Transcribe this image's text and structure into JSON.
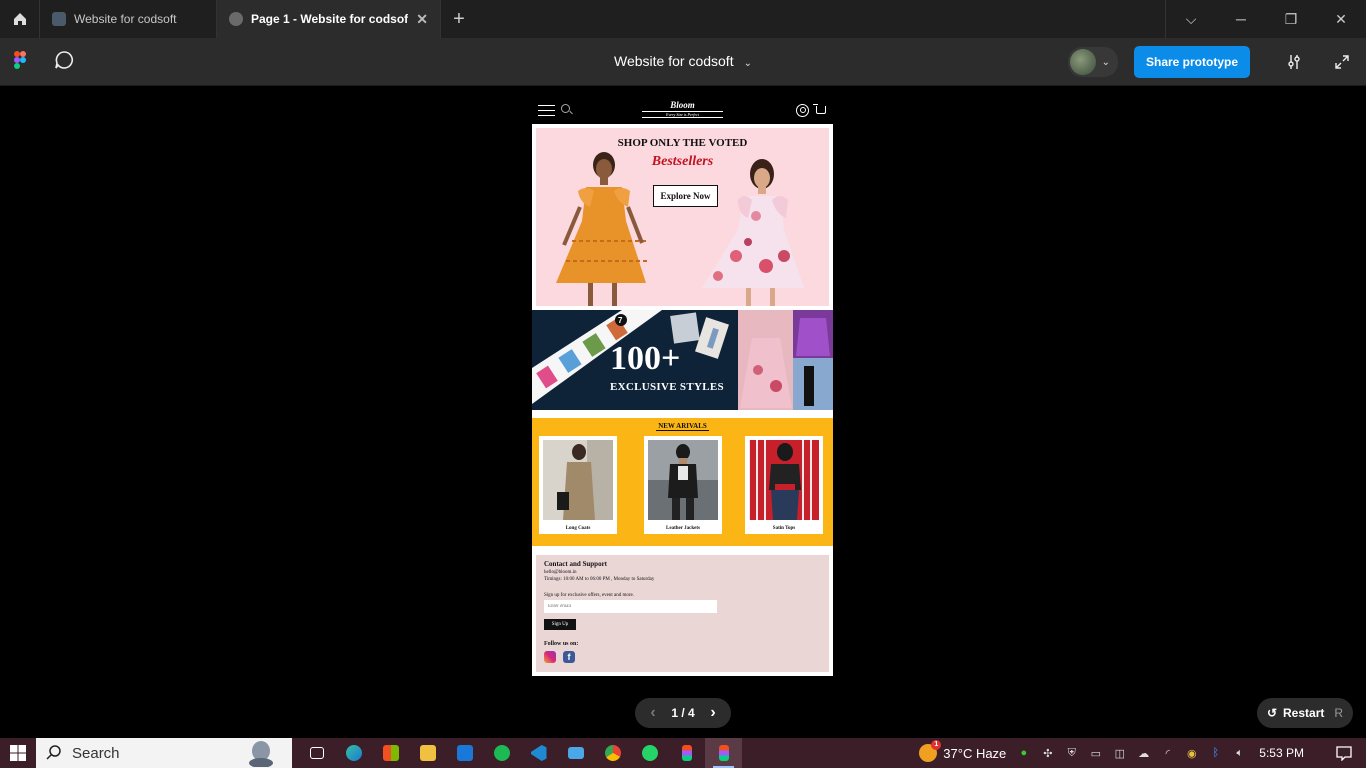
{
  "browser": {
    "tabs": [
      {
        "title": "Website for codsoft",
        "active": false
      },
      {
        "title": "Page 1 - Website for codsoft",
        "active": true
      }
    ]
  },
  "figma": {
    "file_title": "Website for codsoft",
    "share_label": "Share prototype"
  },
  "site": {
    "brand": "Bloom",
    "tagline": "Every Size is Perfect",
    "hero": {
      "headline": "SHOP ONLY THE VOTED",
      "script": "Bestsellers",
      "button": "Explore Now"
    },
    "promo": {
      "big": "100+",
      "sub": "EXCLUSIVE STYLES"
    },
    "arrivals": {
      "title": "NEW ARIVALS",
      "items": [
        {
          "label": "Long Coats"
        },
        {
          "label": "Leather Jackets"
        },
        {
          "label": "Satin Tops"
        }
      ]
    },
    "contact": {
      "title": "Contact and Support",
      "email": "hello@bloom.in",
      "hours": "Timings: 10:00 AM to 06:00 PM , Monday to Saturday",
      "signup_text": "Sign up for exclusive offers, event and more.",
      "email_placeholder": "Enter email",
      "signup_button": "Sign Up",
      "follow": "Follow us on:"
    }
  },
  "pager": {
    "current": "1 / 4"
  },
  "restart": {
    "label": "Restart",
    "shortcut": "R"
  },
  "taskbar": {
    "search_label": "Search",
    "weather": "37°C  Haze",
    "weather_badge": "1",
    "time": "5:53 PM"
  }
}
